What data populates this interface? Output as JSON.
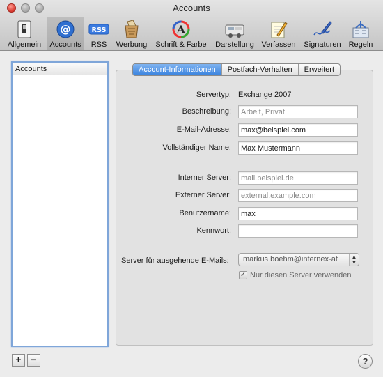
{
  "window": {
    "title": "Accounts"
  },
  "toolbar": {
    "items": [
      {
        "label": "Allgemein",
        "icon": "switch-icon"
      },
      {
        "label": "Accounts",
        "icon": "at-sign-icon",
        "selected": true
      },
      {
        "label": "RSS",
        "icon": "rss-badge-icon"
      },
      {
        "label": "Werbung",
        "icon": "junk-mail-icon"
      },
      {
        "label": "Schrift & Farbe",
        "icon": "font-color-icon"
      },
      {
        "label": "Darstellung",
        "icon": "display-icon"
      },
      {
        "label": "Verfassen",
        "icon": "compose-pencil-icon"
      },
      {
        "label": "Signaturen",
        "icon": "signature-pen-icon"
      },
      {
        "label": "Regeln",
        "icon": "rules-icon"
      }
    ]
  },
  "sidebar": {
    "header": "Accounts",
    "add_label": "+",
    "remove_label": "−"
  },
  "tabs": [
    "Account-Informationen",
    "Postfach-Verhalten",
    "Erweitert"
  ],
  "form": {
    "servertyp": {
      "label": "Servertyp:",
      "value": "Exchange 2007"
    },
    "beschreibung": {
      "label": "Beschreibung:",
      "placeholder": "Arbeit, Privat"
    },
    "email": {
      "label": "E-Mail-Adresse:",
      "value": "max@beispiel.com"
    },
    "name": {
      "label": "Vollständiger Name:",
      "value": "Max Mustermann"
    },
    "intern": {
      "label": "Interner Server:",
      "placeholder": "mail.beispiel.de"
    },
    "extern": {
      "label": "Externer Server:",
      "placeholder": "external.example.com"
    },
    "benutzer": {
      "label": "Benutzername:",
      "value": "max"
    },
    "kennwort": {
      "label": "Kennwort:",
      "value": ""
    },
    "smtp": {
      "label": "Server für ausgehende E-Mails:",
      "value": "markus.boehm@internex-at"
    },
    "only_server": {
      "label": "Nur diesen Server verwenden",
      "checked": true
    }
  },
  "help_label": "?"
}
